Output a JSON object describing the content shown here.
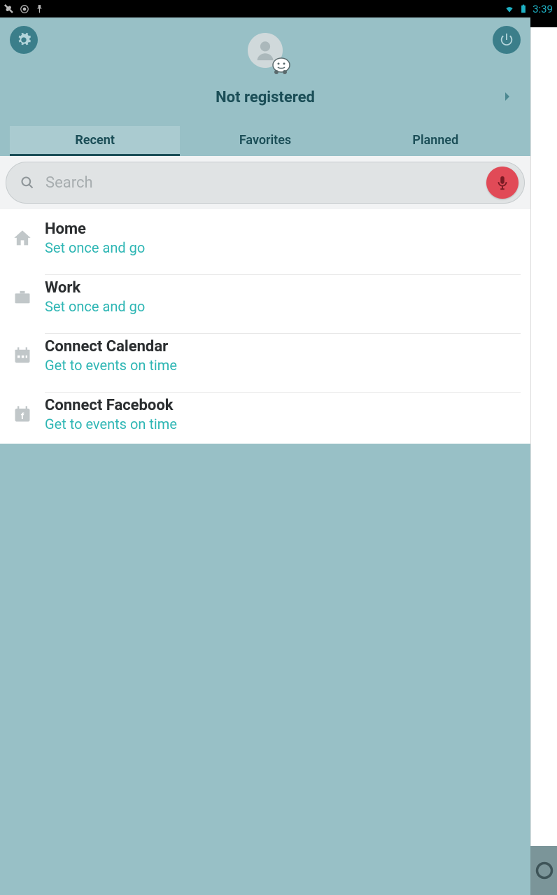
{
  "status": {
    "time": "3:39"
  },
  "header": {
    "title": "Not registered"
  },
  "tabs": [
    {
      "label": "Recent",
      "active": true
    },
    {
      "label": "Favorites",
      "active": false
    },
    {
      "label": "Planned",
      "active": false
    }
  ],
  "search": {
    "placeholder": "Search"
  },
  "items": [
    {
      "icon": "home",
      "title": "Home",
      "subtitle": "Set once and go"
    },
    {
      "icon": "work",
      "title": "Work",
      "subtitle": "Set once and go"
    },
    {
      "icon": "calendar",
      "title": "Connect Calendar",
      "subtitle": "Get to events on time"
    },
    {
      "icon": "facebook",
      "title": "Connect Facebook",
      "subtitle": "Get to events on time"
    }
  ]
}
